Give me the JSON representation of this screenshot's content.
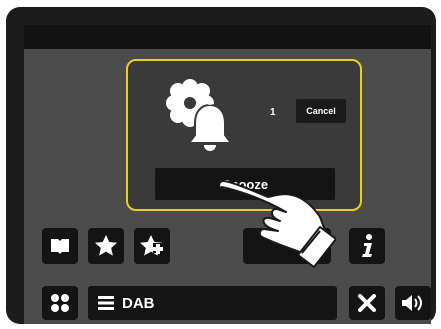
{
  "dialog": {
    "snooze_count": "1",
    "cancel_label": "Cancel",
    "snooze_label": "Snooze",
    "icon": "alarm-bell-icon"
  },
  "toolbar": {
    "icons": [
      "book-icon",
      "star-icon",
      "star-plus-icon",
      "play-icon",
      "info-icon"
    ]
  },
  "bottom_bar": {
    "source_label": "DAB",
    "icons": [
      "apps-icon",
      "menu-icon",
      "close-icon",
      "volume-icon"
    ]
  },
  "colors": {
    "dialog_border": "#e8d21e",
    "screen_bg": "#4c4c4c",
    "button_bg": "#141414"
  }
}
